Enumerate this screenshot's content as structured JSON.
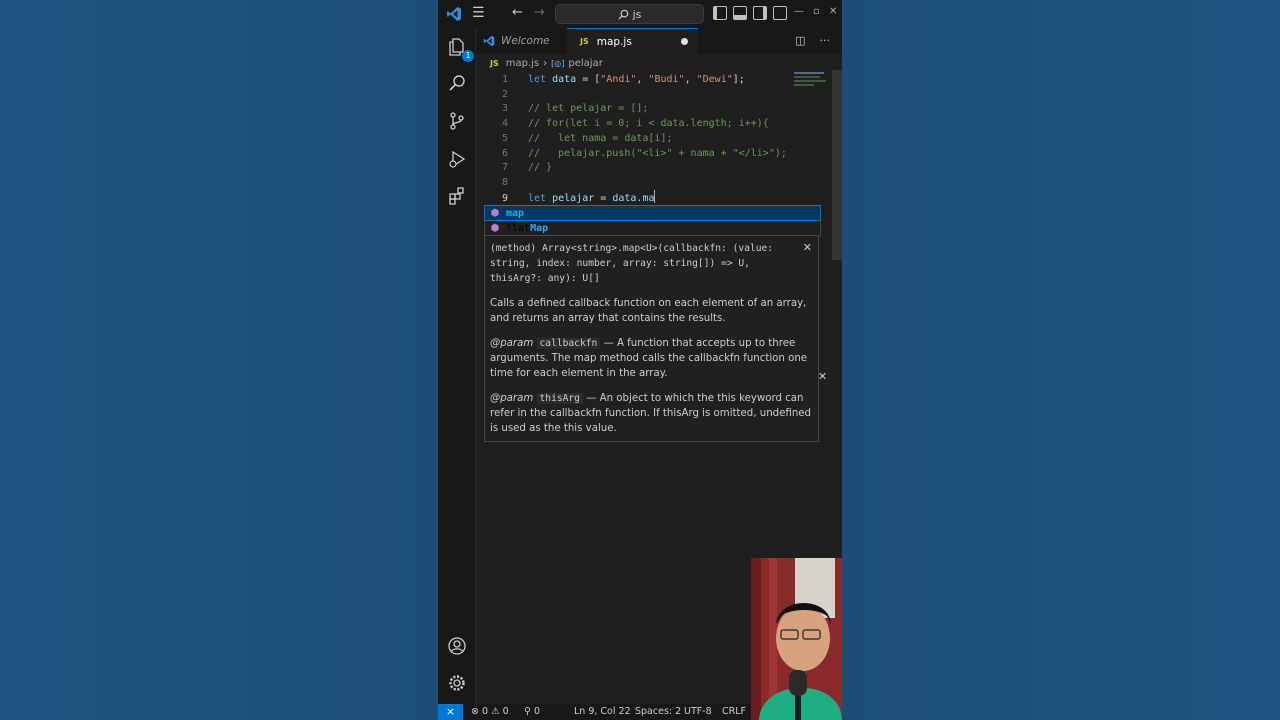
{
  "titlebar": {
    "search_text": "js"
  },
  "tabs": [
    {
      "label": "Welcome"
    },
    {
      "label": "map.js",
      "badge": "JS"
    }
  ],
  "activity": {
    "explorer_badge": "1"
  },
  "breadcrumb": {
    "file": "map.js",
    "symbol": "pelajar",
    "file_badge": "JS"
  },
  "code": [
    {
      "n": "1",
      "tokens": [
        [
          "kw",
          "let "
        ],
        [
          "var",
          "data"
        ],
        [
          "op",
          " = ["
        ],
        [
          "str",
          "\"Andi\""
        ],
        [
          "op",
          ", "
        ],
        [
          "str",
          "\"Budi\""
        ],
        [
          "op",
          ", "
        ],
        [
          "str",
          "\"Dewi\""
        ],
        [
          "op",
          "];"
        ]
      ]
    },
    {
      "n": "2",
      "tokens": []
    },
    {
      "n": "3",
      "tokens": [
        [
          "cm",
          "// let pelajar = [];"
        ]
      ]
    },
    {
      "n": "4",
      "tokens": [
        [
          "cm",
          "// for(let i = 0; i < data.length; i++){"
        ]
      ]
    },
    {
      "n": "5",
      "tokens": [
        [
          "cm",
          "//   let nama = data[i];"
        ]
      ]
    },
    {
      "n": "6",
      "tokens": [
        [
          "cm",
          "//   pelajar.push(\"<li>\" + nama + \"</li>\");"
        ]
      ]
    },
    {
      "n": "7",
      "tokens": [
        [
          "cm",
          "// }"
        ]
      ]
    },
    {
      "n": "8",
      "tokens": []
    },
    {
      "n": "9",
      "tokens": [
        [
          "kw",
          "let "
        ],
        [
          "var",
          "pelajar"
        ],
        [
          "op",
          " = "
        ],
        [
          "var",
          "data"
        ],
        [
          "op",
          "."
        ],
        [
          "var",
          "ma"
        ]
      ]
    }
  ],
  "suggest": {
    "items": [
      {
        "pre": "",
        "hl": "map",
        "post": ""
      },
      {
        "pre": "flat",
        "hl": "Map",
        "post": ""
      }
    ]
  },
  "docs": {
    "signature": "(method) Array<string>.map<U>(callbackfn: (value: string, index: number, array: string[]) => U, thisArg?: any): U[]",
    "description": "Calls a defined callback function on each element of an array, and returns an array that contains the results.",
    "param_tag": "@param",
    "param1_name": "callbackfn",
    "param1_text": "— A function that accepts up to three arguments. The map method calls the callbackfn function one time for each element in the array.",
    "param2_name": "thisArg",
    "param2_text": "— An object to which the this keyword can refer in the callbackfn function. If thisArg is omitted, undefined is used as the this value."
  },
  "status": {
    "errors": "0",
    "warnings": "0",
    "ports": "0",
    "position": "Ln 9, Col 22",
    "spaces": "Spaces: 2",
    "encoding": "UTF-8",
    "eol": "CRLF"
  },
  "colors": {
    "accent": "#0078d4",
    "background": "#1f1f1f",
    "comment": "#6a9955",
    "keyword": "#569cd6",
    "string": "#ce9178"
  }
}
